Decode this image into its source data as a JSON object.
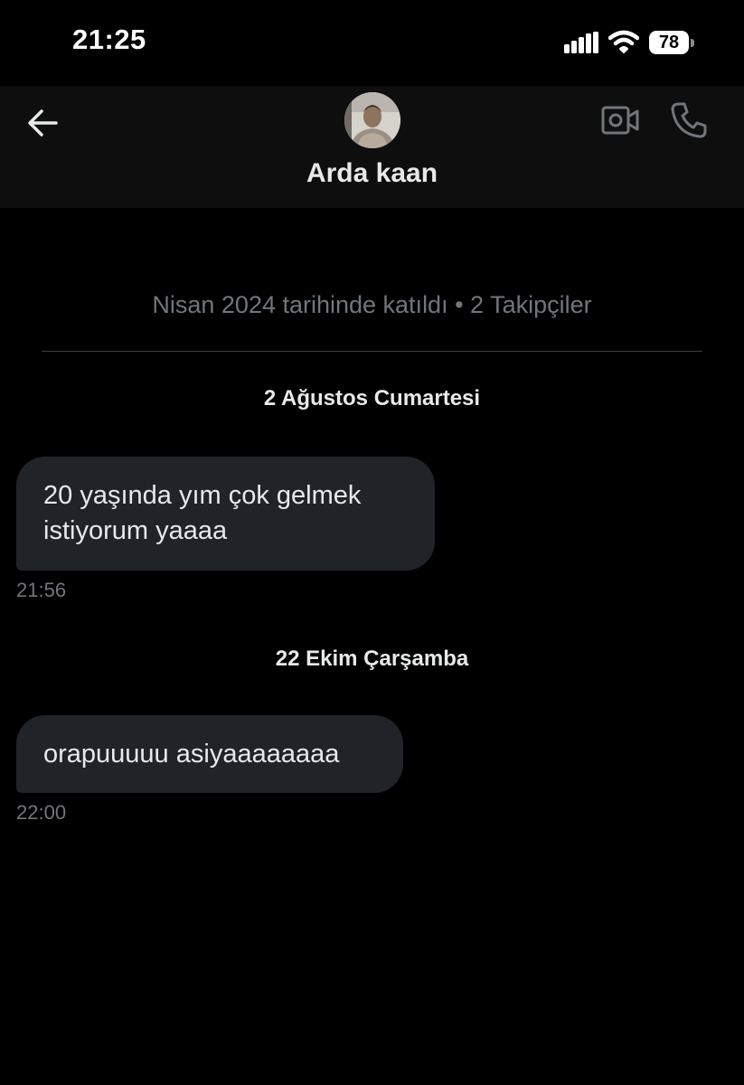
{
  "status_bar": {
    "time": "21:25",
    "battery": "78"
  },
  "header": {
    "contact_name": "Arda kaan"
  },
  "profile_info": {
    "joined_text": "Nisan 2024 tarihinde katıldı • 2 Takipçiler"
  },
  "conversation": [
    {
      "date": "2 Ağustos Cumartesi",
      "message_lines": [
        "20 yaşında yım çok gelmek",
        "istiyorum yaaaa"
      ],
      "time": "21:56"
    },
    {
      "date": "22 Ekim Çarşamba",
      "message_lines": [
        "orapuuuuu asiyaaaaaaaa"
      ],
      "time": "22:00"
    }
  ],
  "colors": {
    "background": "#000000",
    "header_background": "#0e0e0e",
    "bubble_background": "#202327",
    "primary_text": "#e7e9ea",
    "secondary_text": "#71767b"
  },
  "icons": {
    "back": "arrow-left-icon",
    "video": "video-camera-icon",
    "call": "phone-icon",
    "signal": "signal-icon",
    "wifi": "wifi-icon",
    "battery": "battery-icon"
  }
}
